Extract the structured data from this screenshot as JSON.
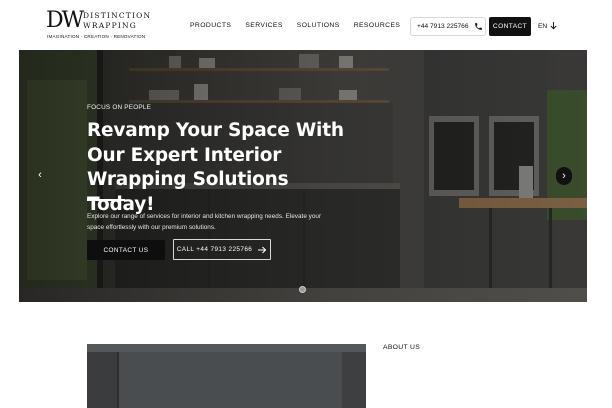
{
  "brand": {
    "logo_mark": "DW",
    "name_line1": "DISTINCTION",
    "name_line2": "WRAPPING",
    "tagline": "IMAGINATION · CREATION · RENOVATION"
  },
  "nav": {
    "items": [
      "PRODUCTS",
      "SERVICES",
      "SOLUTIONS",
      "RESOURCES"
    ]
  },
  "header": {
    "phone": "+44 7913 225766",
    "contact_label": "CONTACT",
    "language": "EN"
  },
  "hero": {
    "eyebrow": "FOCUS ON PEOPLE",
    "title": "Revamp Your Space With Our Expert Interior Wrapping Solutions Today!",
    "description": "Explore our range of services for interior and kitchen wrapping needs. Elevate your space effortlessly with our premium solutions.",
    "primary_button": "CONTACT US",
    "secondary_button": "CALL +44 7913 225766",
    "prev_glyph": "‹",
    "next_glyph": "›",
    "slide_count": 1
  },
  "about": {
    "label": "ABOUT US"
  },
  "colors": {
    "primary": "#111111",
    "white": "#ffffff",
    "hero_overlay": "#3a3a38"
  }
}
